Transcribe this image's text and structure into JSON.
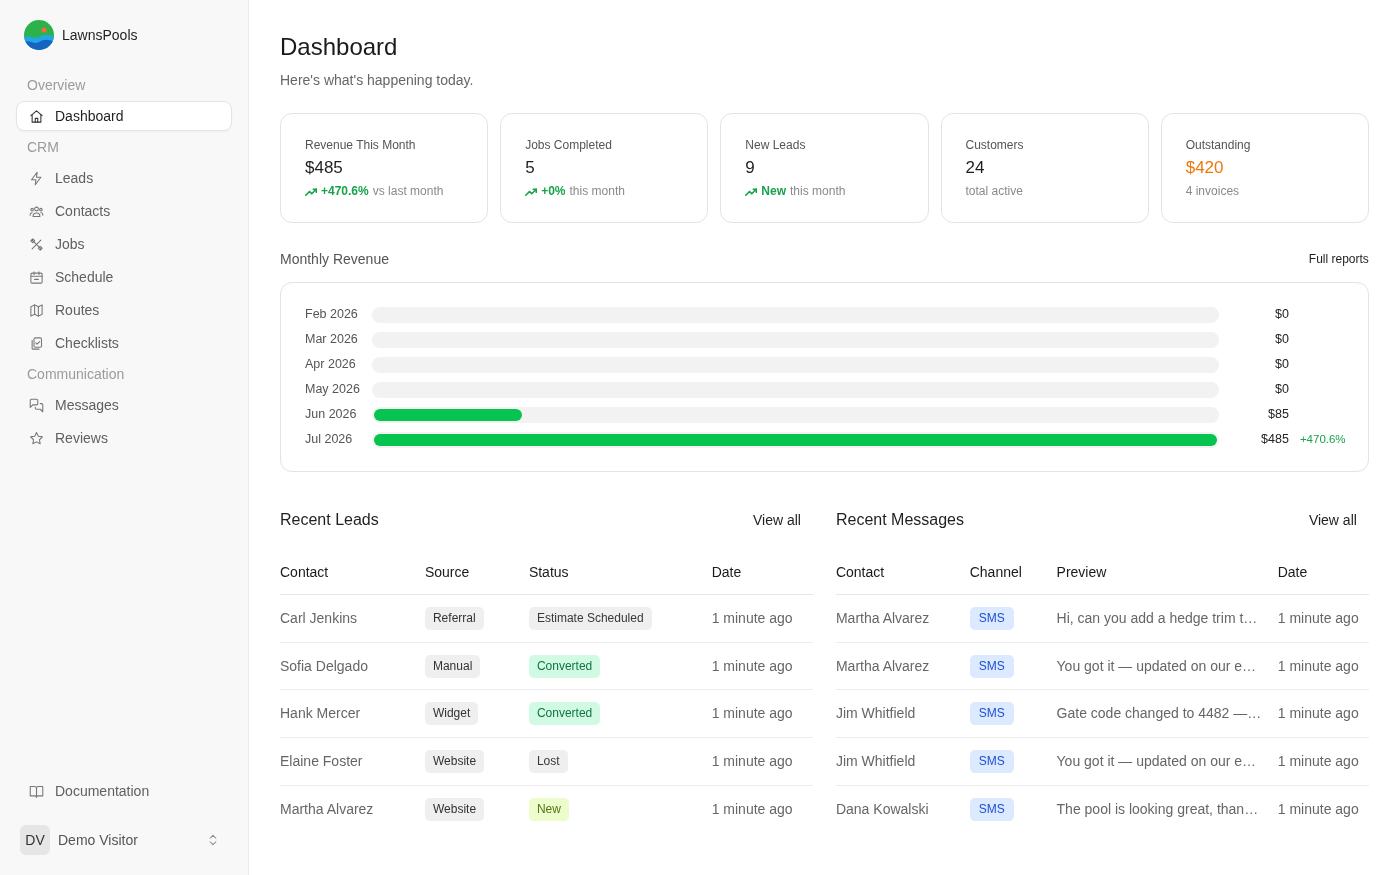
{
  "brand": {
    "name": "LawnsPools"
  },
  "nav_sections": [
    {
      "title": "Overview",
      "items": [
        {
          "label": "Dashboard",
          "selected": true
        }
      ]
    },
    {
      "title": "CRM",
      "items": [
        {
          "label": "Leads",
          "selected": false
        },
        {
          "label": "Contacts",
          "selected": false
        },
        {
          "label": "Jobs",
          "selected": false
        },
        {
          "label": "Schedule",
          "selected": false
        },
        {
          "label": "Routes",
          "selected": false
        },
        {
          "label": "Checklists",
          "selected": false
        }
      ]
    },
    {
      "title": "Communication",
      "items": [
        {
          "label": "Messages",
          "selected": false
        },
        {
          "label": "Reviews",
          "selected": false
        }
      ]
    }
  ],
  "footer_links": [
    {
      "label": "Documentation"
    }
  ],
  "user": {
    "initials": "DV",
    "name": "Demo Visitor"
  },
  "page": {
    "title": "Dashboard",
    "subtitle": "Here's what's happening today."
  },
  "stats": [
    {
      "label": "Revenue This Month",
      "value": "$485",
      "change": "+470.6%",
      "note": "vs last month",
      "alert": false
    },
    {
      "label": "Jobs Completed",
      "value": "5",
      "change": "+0%",
      "note": "this month",
      "alert": false
    },
    {
      "label": "New Leads",
      "value": "9",
      "change": "New",
      "note": "this month",
      "alert": false
    },
    {
      "label": "Customers",
      "value": "24",
      "note": "total active",
      "alert": false
    },
    {
      "label": "Outstanding",
      "value": "$420",
      "note": "4 invoices",
      "alert": true
    }
  ],
  "revenue": {
    "title": "Monthly Revenue",
    "link": "Full reports",
    "rows": [
      {
        "month": "Feb 2026",
        "amount": "$0"
      },
      {
        "month": "Mar 2026",
        "amount": "$0"
      },
      {
        "month": "Apr 2026",
        "amount": "$0"
      },
      {
        "month": "May 2026",
        "amount": "$0"
      },
      {
        "month": "Jun 2026",
        "level": 0.175,
        "amount": "$85"
      },
      {
        "month": "Jul 2026",
        "level": 1,
        "amount": "$485",
        "change": "+470.6%"
      }
    ]
  },
  "recent_leads": {
    "title": "Recent Leads",
    "link": "View all",
    "columns": [
      "Contact",
      "Source",
      "Status",
      "Date"
    ],
    "rows": [
      {
        "contact": "Carl Jenkins",
        "source": "Referral",
        "status": {
          "label": "Estimate Scheduled",
          "color": "#efefef"
        },
        "date": "1 minute ago"
      },
      {
        "contact": "Sofia Delgado",
        "source": "Manual",
        "status": {
          "label": "Converted",
          "color": "#d1fae5"
        },
        "date": "1 minute ago"
      },
      {
        "contact": "Hank Mercer",
        "source": "Widget",
        "status": {
          "label": "Converted",
          "color": "#d1fae5"
        },
        "date": "1 minute ago"
      },
      {
        "contact": "Elaine Foster",
        "source": "Website",
        "status": {
          "label": "Lost",
          "color": "#efefef"
        },
        "date": "1 minute ago"
      },
      {
        "contact": "Martha Alvarez",
        "source": "Website",
        "status": {
          "label": "New",
          "color": "#ecfccb"
        },
        "date": "1 minute ago"
      }
    ]
  },
  "recent_messages": {
    "title": "Recent Messages",
    "link": "View all",
    "columns": [
      "Contact",
      "Channel",
      "Preview",
      "Date"
    ],
    "rows": [
      {
        "contact": "Martha Alvarez",
        "channel": "SMS",
        "preview": "Hi, can you add a hedge trim t…",
        "date": "1 minute ago"
      },
      {
        "contact": "Martha Alvarez",
        "channel": "SMS",
        "preview": "You got it — updated on our e…",
        "date": "1 minute ago"
      },
      {
        "contact": "Jim Whitfield",
        "channel": "SMS",
        "preview": "Gate code changed to 4482 —…",
        "date": "1 minute ago"
      },
      {
        "contact": "Jim Whitfield",
        "channel": "SMS",
        "preview": "You got it — updated on our e…",
        "date": "1 minute ago"
      },
      {
        "contact": "Dana Kowalski",
        "channel": "SMS",
        "preview": "The pool is looking great, than…",
        "date": "1 minute ago"
      }
    ]
  }
}
